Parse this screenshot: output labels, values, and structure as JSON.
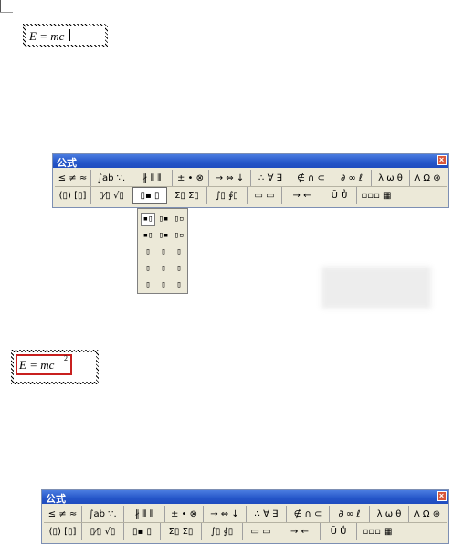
{
  "equation1": {
    "text": "E = mc"
  },
  "equation2": {
    "text": "E = mc",
    "superscript": "2"
  },
  "toolbar_top": {
    "title": "公式",
    "close_glyph": "×",
    "row1": [
      "≤ ≠ ≈",
      "∫ab ∵.",
      "∦ ⦀ ⦀",
      "± • ⊗",
      "→ ⇔ ↓",
      "∴ ∀ ∃",
      "∉ ∩ ⊂",
      "∂ ∞ ℓ",
      "λ ω θ",
      "Λ Ω ⊛"
    ],
    "row2": [
      "(▯) [▯]",
      "▯⁄▯ √▯",
      "▯▪ ▯",
      "Σ▯ Σ▯",
      "∫▯ ∮▯",
      "▭ ▭",
      "→ ←",
      "Ū Ů",
      "▫▫▫ ▦"
    ]
  },
  "toolbar_bottom": {
    "title": "公式",
    "close_glyph": "×",
    "row1": [
      "≤ ≠ ≈",
      "∫ab ∵.",
      "∦ ⦀ ⦀",
      "± • ⊗",
      "→ ⇔ ↓",
      "∴ ∀ ∃",
      "∉ ∩ ⊂",
      "∂ ∞ ℓ",
      "λ ω θ",
      "Λ Ω ⊛"
    ],
    "row2": [
      "(▯) [▯]",
      "▯⁄▯ √▯",
      "▯▪ ▯",
      "Σ▯ Σ▯",
      "∫▯ ∮▯",
      "▭ ▭",
      "→ ←",
      "Ū Ů",
      "▫▫▫ ▦"
    ]
  },
  "script_palette": {
    "cells": [
      "▪▯",
      "▯▪",
      "▯▫",
      "▪▯",
      "▯▪",
      "▯▫",
      "▯",
      "▯",
      "▯",
      "▯",
      "▯",
      "▯",
      "▯",
      "▯",
      "▯"
    ]
  },
  "colors": {
    "highlight_box": "#c8201f",
    "titlebar": "#2455c8"
  }
}
